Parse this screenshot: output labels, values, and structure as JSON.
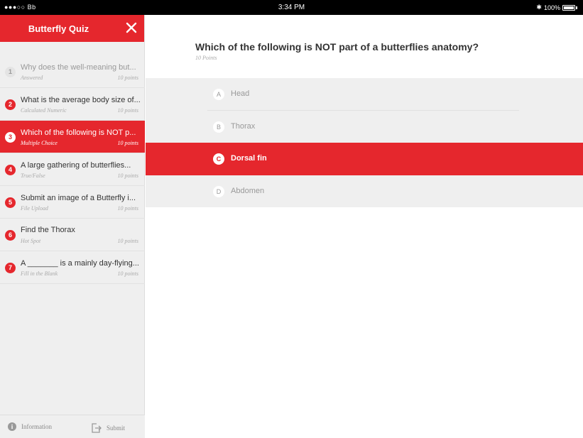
{
  "status_bar": {
    "carrier": "●●●○○ Bb",
    "time": "3:34 PM",
    "battery": "100%"
  },
  "sidebar": {
    "title": "Butterfly Quiz",
    "questions": [
      {
        "number": "1",
        "text": "Why does the well-meaning but...",
        "type": "Answered",
        "points": "10 points",
        "state": "answered"
      },
      {
        "number": "2",
        "text": "What is the average body size of...",
        "type": "Calculated Numeric",
        "points": "10 points",
        "state": "unanswered"
      },
      {
        "number": "3",
        "text": "Which of the following is NOT p...",
        "type": "Multiple Choice",
        "points": "10 points",
        "state": "active"
      },
      {
        "number": "4",
        "text": "A large gathering of butterflies...",
        "type": "True/False",
        "points": "10 points",
        "state": "unanswered"
      },
      {
        "number": "5",
        "text": "Submit an image of a Butterfly i...",
        "type": "File Upload",
        "points": "10 points",
        "state": "unanswered"
      },
      {
        "number": "6",
        "text": "Find the Thorax",
        "type": "Hot Spot",
        "points": "10 points",
        "state": "unanswered"
      },
      {
        "number": "7",
        "text": "A _______ is a mainly day-flying...",
        "type": "Fill in the Blank",
        "points": "10 points",
        "state": "unanswered"
      }
    ],
    "footer": {
      "information_label": "Information",
      "submit_label": "Submit"
    }
  },
  "main": {
    "question": "Which of the following is NOT part of a butterflies anatomy?",
    "points": "10 Points",
    "options": [
      {
        "letter": "A",
        "label": "Head",
        "selected": false
      },
      {
        "letter": "B",
        "label": "Thorax",
        "selected": false
      },
      {
        "letter": "C",
        "label": "Dorsal fin",
        "selected": true
      },
      {
        "letter": "D",
        "label": "Abdomen",
        "selected": false
      }
    ]
  },
  "colors": {
    "accent": "#e5272d",
    "sidebar_bg": "#efefef"
  }
}
